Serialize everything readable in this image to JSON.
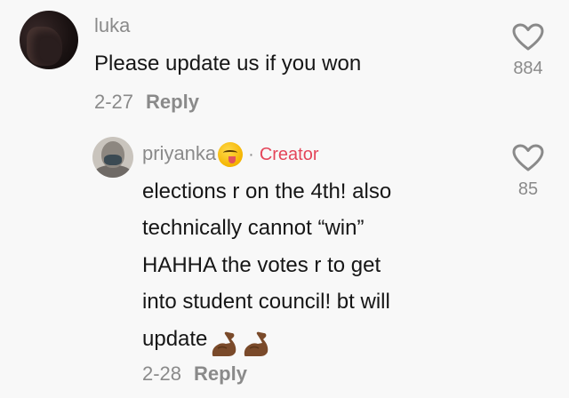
{
  "comments": [
    {
      "username": "luka",
      "text_lines": [
        "Please update us if you won"
      ],
      "date": "2-27",
      "reply_label": "Reply",
      "likes": "884",
      "icon": "heart-outline-icon"
    }
  ],
  "reply": {
    "username": "priyanka",
    "username_emoji": "savoring-face-emoji",
    "separator": "·",
    "badge": "Creator",
    "text_lines": [
      "elections r on the 4th! also",
      "technically cannot “win”",
      "HAHHA the votes r to get",
      "into student council! bt will",
      "update"
    ],
    "trailing_emojis": [
      "flexed-biceps-emoji",
      "flexed-biceps-emoji"
    ],
    "date": "2-28",
    "reply_label": "Reply",
    "likes": "85",
    "icon": "heart-outline-icon"
  },
  "colors": {
    "background": "#f8f8f8",
    "secondary_text": "#8a8a8a",
    "primary_text": "#161616",
    "creator_badge": "#e4465a"
  }
}
